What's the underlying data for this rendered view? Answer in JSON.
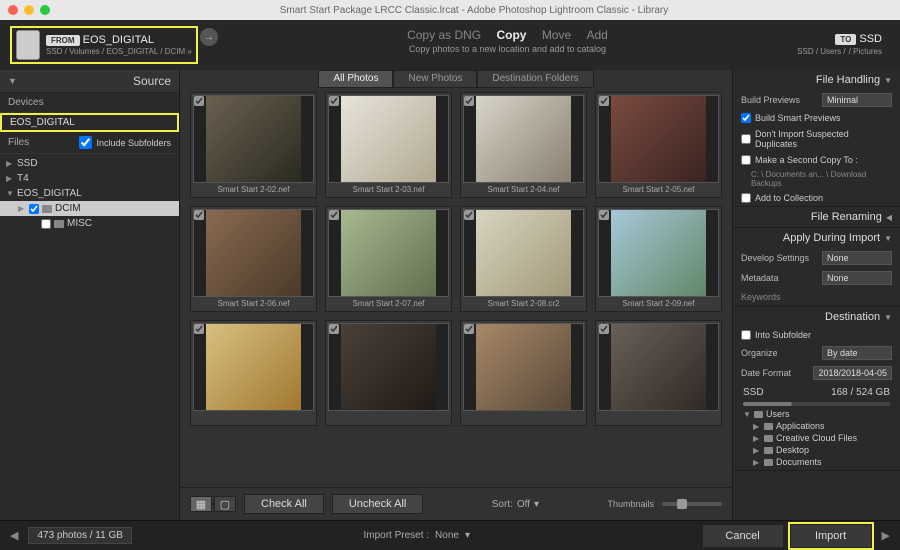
{
  "title": "Smart Start Package LRCC Classic.lrcat - Adobe Photoshop Lightroom Classic - Library",
  "topbar": {
    "from_label": "FROM",
    "source_name": "EOS_DIGITAL",
    "source_path": "SSD / Volumes / EOS_DIGITAL / DCIM »",
    "actions": {
      "copy_dng": "Copy as DNG",
      "copy": "Copy",
      "move": "Move",
      "add": "Add"
    },
    "hint": "Copy photos to a new location and add to catalog",
    "to_label": "TO",
    "dest_name": "SSD",
    "dest_sub": "SSD / Users /",
    "dest_folder": "/ Pictures"
  },
  "left": {
    "source": "Source",
    "devices": "Devices",
    "device_selected": "EOS_DIGITAL",
    "files": "Files",
    "include": "Include Subfolders",
    "drives": [
      "SSD",
      "T4",
      "EOS_DIGITAL"
    ],
    "folders": [
      "DCIM",
      "MISC"
    ]
  },
  "center": {
    "tabs": {
      "all": "All Photos",
      "new": "New Photos",
      "dest": "Destination Folders"
    },
    "thumbs": [
      {
        "fn": "Smart Start 2-02.nef",
        "c1": "#6b6050",
        "c2": "#2a2a20"
      },
      {
        "fn": "Smart Start 2-03.nef",
        "c1": "#e8e4dc",
        "c2": "#b0a890"
      },
      {
        "fn": "Smart Start 2-04.nef",
        "c1": "#d8d4c8",
        "c2": "#888070"
      },
      {
        "fn": "Smart Start 2-05.nef",
        "c1": "#7a4a40",
        "c2": "#3a2420"
      },
      {
        "fn": "Smart Start 2-06.nef",
        "c1": "#8a6a50",
        "c2": "#4a3a2a"
      },
      {
        "fn": "Smart Start 2-07.nef",
        "c1": "#a8b890",
        "c2": "#607050"
      },
      {
        "fn": "Smart Start 2-08.cr2",
        "c1": "#d8d4c0",
        "c2": "#a09878"
      },
      {
        "fn": "Smart Start 2-09.nef",
        "c1": "#a8c8d8",
        "c2": "#608868"
      },
      {
        "fn": "",
        "c1": "#d8c080",
        "c2": "#a07830"
      },
      {
        "fn": "",
        "c1": "#4a4038",
        "c2": "#201a16"
      },
      {
        "fn": "",
        "c1": "#a88868",
        "c2": "#584838"
      },
      {
        "fn": "",
        "c1": "#686058",
        "c2": "#302a24"
      }
    ],
    "buttons": {
      "check": "Check All",
      "uncheck": "Uncheck All"
    },
    "sort": {
      "label": "Sort:",
      "value": "Off"
    },
    "thumb_label": "Thumbnails"
  },
  "right": {
    "file_handling": {
      "title": "File Handling",
      "build_previews": "Build Previews",
      "build_previews_val": "Minimal",
      "smart": "Build Smart Previews",
      "dupes": "Don't Import Suspected Duplicates",
      "second": "Make a Second Copy To :",
      "second_path": "C: \\ Documents an... \\ Download Backups",
      "collection": "Add to Collection"
    },
    "file_renaming": "File Renaming",
    "apply": {
      "title": "Apply During Import",
      "dev": "Develop Settings",
      "dev_val": "None",
      "meta": "Metadata",
      "meta_val": "None",
      "keywords": "Keywords"
    },
    "destination": {
      "title": "Destination",
      "into": "Into Subfolder",
      "organize": "Organize",
      "organize_val": "By date",
      "dateformat": "Date Format",
      "dateformat_val": "2018/2018-04-05",
      "disk": "SSD",
      "disk_info": "168 / 524 GB",
      "tree": [
        "Users",
        "Applications",
        "Creative Cloud Files",
        "Desktop",
        "Documents"
      ]
    }
  },
  "footer": {
    "status": "473 photos / 11 GB",
    "preset_label": "Import Preset :",
    "preset_val": "None",
    "cancel": "Cancel",
    "import": "Import"
  }
}
